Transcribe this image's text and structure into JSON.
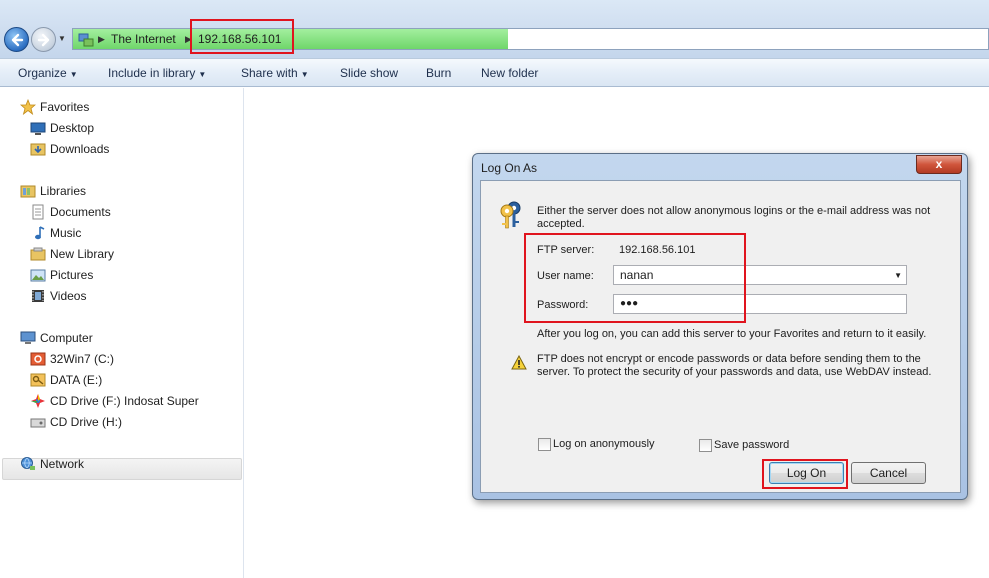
{
  "address": {
    "crumbs": [
      "The Internet",
      "192.168.56.101"
    ]
  },
  "toolbar": {
    "organize": "Organize",
    "include_in_library": "Include in library",
    "share_with": "Share with",
    "slide_show": "Slide show",
    "burn": "Burn",
    "new_folder": "New folder"
  },
  "sidebar": {
    "favorites": "Favorites",
    "desktop": "Desktop",
    "downloads": "Downloads",
    "libraries": "Libraries",
    "documents": "Documents",
    "music": "Music",
    "new_library": "New Library",
    "pictures": "Pictures",
    "videos": "Videos",
    "computer": "Computer",
    "drive_c": "32Win7  (C:)",
    "drive_e": "DATA (E:)",
    "drive_f": "CD Drive (F:) Indosat Super",
    "drive_h": "CD Drive (H:)",
    "network": "Network"
  },
  "dialog": {
    "title": "Log On As",
    "close": "x",
    "intro": "Either the server does not allow anonymous logins or the e-mail address was not accepted.",
    "ftp_server_label": "FTP server:",
    "ftp_server_value": "192.168.56.101",
    "username_label": "User name:",
    "username_value": "nanan",
    "password_label": "Password:",
    "password_value": "●●●",
    "after_logon": "After you log on, you can add this server to your Favorites and return to it easily.",
    "warning": "FTP does not encrypt or encode passwords or data before sending them to the server.  To protect the security of your passwords and data, use WebDAV instead.",
    "log_on_anonymously": "Log on anonymously",
    "save_password": "Save password",
    "log_on_button": "Log On",
    "cancel_button": "Cancel"
  },
  "colors": {
    "highlight_red": "#e0141e",
    "progress_green": "#6fd66a"
  }
}
